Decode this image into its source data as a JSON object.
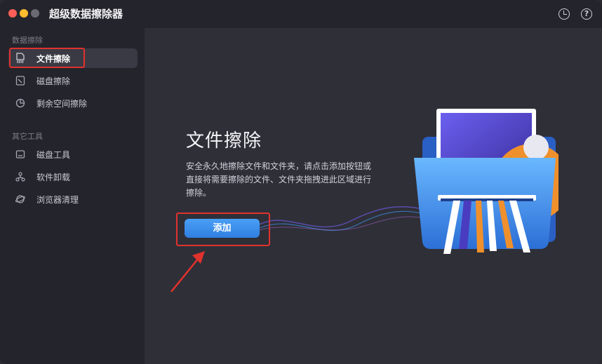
{
  "window": {
    "title": "超级数据擦除器"
  },
  "titlebar": {
    "history_icon": "clock-icon",
    "help_icon": "help-icon",
    "help_glyph": "?"
  },
  "sidebar": {
    "section1_label": "数据擦除",
    "section2_label": "其它工具",
    "items": [
      {
        "label": "文件擦除",
        "icon": "document-shred-icon",
        "active": true
      },
      {
        "label": "磁盘擦除",
        "icon": "disk-icon",
        "active": false
      },
      {
        "label": "剩余空间擦除",
        "icon": "pie-icon",
        "active": false
      },
      {
        "label": "磁盘工具",
        "icon": "disk-tool-icon",
        "active": false
      },
      {
        "label": "软件卸载",
        "icon": "uninstall-icon",
        "active": false
      },
      {
        "label": "浏览器清理",
        "icon": "browser-icon",
        "active": false
      }
    ]
  },
  "main": {
    "heading": "文件擦除",
    "description": "安全永久地擦除文件和文件夹，请点击添加按钮或直接将需要擦除的文件、文件夹拖拽进此区域进行擦除。",
    "add_button": "添加"
  },
  "colors": {
    "accent": "#3a8ef0",
    "highlight_box": "#e0322d",
    "sidebar_bg": "#24242c",
    "main_bg": "#2f2f38"
  }
}
